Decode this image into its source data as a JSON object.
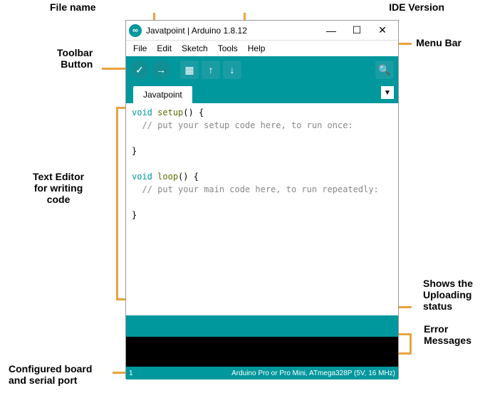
{
  "annotations": {
    "filename": "File name",
    "ide_version": "IDE Version",
    "menubar": "Menu Bar",
    "toolbar": "Toolbar\nButton",
    "text_editor": "Text Editor\nfor writing\ncode",
    "upload_status": "Shows the\nUploading\nstatus",
    "error_messages": "Error\nMessages",
    "board_port": "Configured board\nand serial port"
  },
  "window": {
    "title": "Javatpoint | Arduino 1.8.12"
  },
  "menu": {
    "file": "File",
    "edit": "Edit",
    "sketch": "Sketch",
    "tools": "Tools",
    "help": "Help"
  },
  "toolbar_icons": {
    "verify": "✓",
    "upload": "→",
    "new": "▦",
    "open": "↑",
    "save": "↓",
    "serial": "🔍"
  },
  "tab": {
    "name": "Javatpoint",
    "dropdown": "▼"
  },
  "code": {
    "line1_kw": "void",
    "line1_fn": "setup",
    "line1_rest": "() {",
    "line2": "  // put your setup code here, to run once:",
    "line3": "",
    "line4": "}",
    "line5": "",
    "line6_kw": "void",
    "line6_fn": "loop",
    "line6_rest": "() {",
    "line7": "  // put your main code here, to run repeatedly:",
    "line8": "",
    "line9": "}"
  },
  "footer": {
    "line": "1",
    "board": "Arduino Pro or Pro Mini, ATmega328P (5V, 16 MHz)"
  }
}
